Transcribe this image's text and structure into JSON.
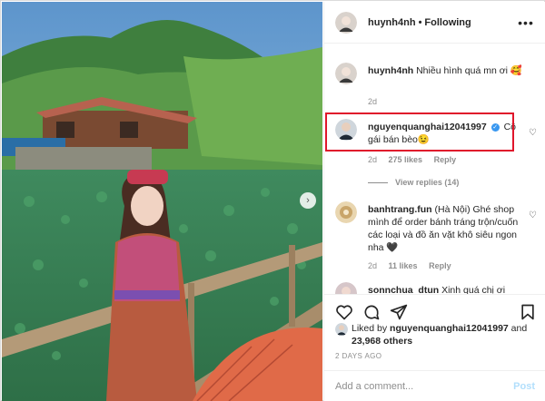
{
  "header": {
    "username": "huynh4nh",
    "separator": "•",
    "follow_status": "Following",
    "more_icon": "more-options-icon"
  },
  "comments": [
    {
      "username": "huynh4nh",
      "text": "Nhiều hình quá mn ơi 🥰",
      "time": "2d"
    },
    {
      "username": "nguyenquanghai12041997",
      "verified": true,
      "text": "Cô gái bán bèo😉",
      "time": "2d",
      "likes": "275 likes",
      "reply": "Reply",
      "view_replies": "View replies (14)",
      "highlighted": true
    },
    {
      "username": "banhtrang.fun",
      "text": "(Hà Nội) Ghé shop mình để order bánh tráng trộn/cuốn các loại và đồ ăn vặt khô siêu ngon nha 🖤",
      "time": "2d",
      "likes": "11 likes",
      "reply": "Reply"
    },
    {
      "username": "sonnchua_dtun",
      "text": "Xinh quá chị ơi"
    }
  ],
  "actions": {
    "like_icon": "heart-icon",
    "comment_icon": "comment-icon",
    "share_icon": "share-icon",
    "save_icon": "bookmark-icon"
  },
  "likes": {
    "prefix": "Liked by",
    "user": "nguyenquanghai12041997",
    "and": "and",
    "others": "23,968 others"
  },
  "timestamp": "2 DAYS AGO",
  "add_comment": {
    "placeholder": "Add a comment...",
    "post_label": "Post"
  },
  "colors": {
    "highlight": "#e0162b",
    "verified": "#3897f0",
    "muted": "#8e8e8e",
    "post_disabled": "#b2dffc"
  }
}
